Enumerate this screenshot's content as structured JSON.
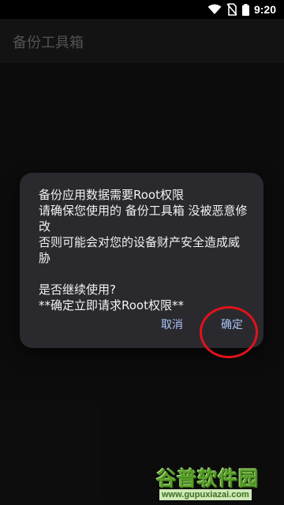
{
  "status_bar": {
    "time": "9:20",
    "icons": [
      "wifi-icon",
      "no-sim-icon",
      "battery-icon"
    ]
  },
  "app_bar": {
    "title": "备份工具箱"
  },
  "dialog": {
    "message_lines": [
      "备份应用数据需要Root权限",
      "请确保您使用的 备份工具箱 没被恶意修改",
      "否则可能会对您的设备财产安全造成威胁",
      "",
      "是否继续使用?",
      "**确定立即请求Root权限**"
    ],
    "cancel_label": "取消",
    "confirm_label": "确定"
  },
  "watermark": {
    "brand": "谷普软件园",
    "url": "www.gupuxiazai.com"
  },
  "colors": {
    "accent": "#a9c4f7",
    "highlight": "#e0131b",
    "dialog_bg": "#2a2a2e",
    "watermark_green": "#5aa12c"
  }
}
